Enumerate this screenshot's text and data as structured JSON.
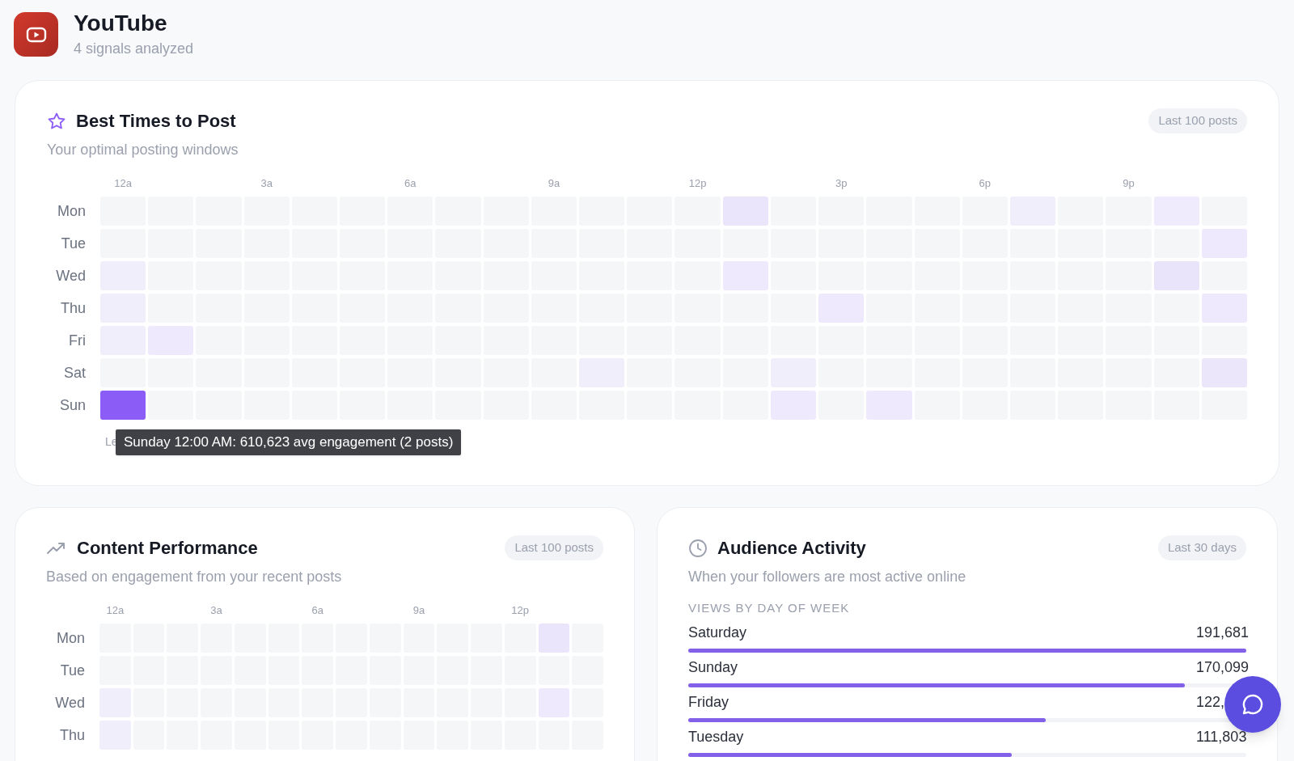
{
  "channel": {
    "name": "YouTube",
    "subtitle": "4 signals analyzed"
  },
  "best_times": {
    "title": "Best Times to Post",
    "subtitle": "Your optimal posting windows",
    "badge": "Last 100 posts",
    "hour_ticks": [
      "12a",
      "3a",
      "6a",
      "9a",
      "12p",
      "3p",
      "6p",
      "9p"
    ],
    "rows": [
      {
        "day": "Mon",
        "cells": [
          {
            "color": "#f5f6f8"
          },
          {
            "color": "#f5f6f8"
          },
          {
            "color": "#f5f6f8"
          },
          {
            "color": "#f5f6f8"
          },
          {
            "color": "#f5f6f8"
          },
          {
            "color": "#f5f6f8"
          },
          {
            "color": "#f5f6f8"
          },
          {
            "color": "#f5f6f8"
          },
          {
            "color": "#f5f6f8"
          },
          {
            "color": "#f5f6f8"
          },
          {
            "color": "#f5f6f8"
          },
          {
            "color": "#f5f6f8"
          },
          {
            "color": "#f5f6f8"
          },
          {
            "color": "#ebe5fb"
          },
          {
            "color": "#f5f6f8"
          },
          {
            "color": "#f5f6f8"
          },
          {
            "color": "#f5f6f8"
          },
          {
            "color": "#f5f6f8"
          },
          {
            "color": "#f5f6f8"
          },
          {
            "color": "#f1eefc"
          },
          {
            "color": "#f5f6f8"
          },
          {
            "color": "#f5f6f8"
          },
          {
            "color": "#efebfc"
          },
          {
            "color": "#f5f6f8"
          }
        ]
      },
      {
        "day": "Tue",
        "cells": [
          {
            "color": "#f5f6f8"
          },
          {
            "color": "#f5f6f8"
          },
          {
            "color": "#f5f6f8"
          },
          {
            "color": "#f5f6f8"
          },
          {
            "color": "#f5f6f8"
          },
          {
            "color": "#f5f6f8"
          },
          {
            "color": "#f5f6f8"
          },
          {
            "color": "#f5f6f8"
          },
          {
            "color": "#f5f6f8"
          },
          {
            "color": "#f5f6f8"
          },
          {
            "color": "#f5f6f8"
          },
          {
            "color": "#f5f6f8"
          },
          {
            "color": "#f5f6f8"
          },
          {
            "color": "#f5f6f8"
          },
          {
            "color": "#f5f6f8"
          },
          {
            "color": "#f5f6f8"
          },
          {
            "color": "#f5f6f8"
          },
          {
            "color": "#f5f6f8"
          },
          {
            "color": "#f5f6f8"
          },
          {
            "color": "#f5f6f8"
          },
          {
            "color": "#f5f6f8"
          },
          {
            "color": "#f5f6f8"
          },
          {
            "color": "#f5f6f8"
          },
          {
            "color": "#eee9fc"
          }
        ]
      },
      {
        "day": "Wed",
        "cells": [
          {
            "color": "#f1eefc"
          },
          {
            "color": "#f5f6f8"
          },
          {
            "color": "#f5f6f8"
          },
          {
            "color": "#f5f6f8"
          },
          {
            "color": "#f5f6f8"
          },
          {
            "color": "#f5f6f8"
          },
          {
            "color": "#f5f6f8"
          },
          {
            "color": "#f5f6f8"
          },
          {
            "color": "#f5f6f8"
          },
          {
            "color": "#f5f6f8"
          },
          {
            "color": "#f5f6f8"
          },
          {
            "color": "#f5f6f8"
          },
          {
            "color": "#f5f6f8"
          },
          {
            "color": "#eee9fc"
          },
          {
            "color": "#f5f6f8"
          },
          {
            "color": "#f5f6f8"
          },
          {
            "color": "#f5f6f8"
          },
          {
            "color": "#f5f6f8"
          },
          {
            "color": "#f5f6f8"
          },
          {
            "color": "#f5f6f8"
          },
          {
            "color": "#f5f6f8"
          },
          {
            "color": "#f5f6f8"
          },
          {
            "color": "#e9e4fa"
          },
          {
            "color": "#f5f6f8"
          }
        ]
      },
      {
        "day": "Thu",
        "cells": [
          {
            "color": "#f1eefc"
          },
          {
            "color": "#f5f6f8"
          },
          {
            "color": "#f5f6f8"
          },
          {
            "color": "#f5f6f8"
          },
          {
            "color": "#f5f6f8"
          },
          {
            "color": "#f5f6f8"
          },
          {
            "color": "#f5f6f8"
          },
          {
            "color": "#f5f6f8"
          },
          {
            "color": "#f5f6f8"
          },
          {
            "color": "#f5f6f8"
          },
          {
            "color": "#f5f6f8"
          },
          {
            "color": "#f5f6f8"
          },
          {
            "color": "#f5f6f8"
          },
          {
            "color": "#f5f6f8"
          },
          {
            "color": "#f5f6f8"
          },
          {
            "color": "#eee9fc"
          },
          {
            "color": "#f5f6f8"
          },
          {
            "color": "#f5f6f8"
          },
          {
            "color": "#f5f6f8"
          },
          {
            "color": "#f5f6f8"
          },
          {
            "color": "#f5f6f8"
          },
          {
            "color": "#f5f6f8"
          },
          {
            "color": "#f5f6f8"
          },
          {
            "color": "#eee9fc"
          }
        ]
      },
      {
        "day": "Fri",
        "cells": [
          {
            "color": "#f1eefc"
          },
          {
            "color": "#eee9fc"
          },
          {
            "color": "#f5f6f8"
          },
          {
            "color": "#f5f6f8"
          },
          {
            "color": "#f5f6f8"
          },
          {
            "color": "#f5f6f8"
          },
          {
            "color": "#f5f6f8"
          },
          {
            "color": "#f5f6f8"
          },
          {
            "color": "#f5f6f8"
          },
          {
            "color": "#f5f6f8"
          },
          {
            "color": "#f5f6f8"
          },
          {
            "color": "#f5f6f8"
          },
          {
            "color": "#f5f6f8"
          },
          {
            "color": "#f5f6f8"
          },
          {
            "color": "#f5f6f8"
          },
          {
            "color": "#f5f6f8"
          },
          {
            "color": "#f5f6f8"
          },
          {
            "color": "#f5f6f8"
          },
          {
            "color": "#f5f6f8"
          },
          {
            "color": "#f5f6f8"
          },
          {
            "color": "#f5f6f8"
          },
          {
            "color": "#f5f6f8"
          },
          {
            "color": "#f5f6f8"
          },
          {
            "color": "#f5f6f8"
          }
        ]
      },
      {
        "day": "Sat",
        "cells": [
          {
            "color": "#f5f6f8"
          },
          {
            "color": "#f5f6f8"
          },
          {
            "color": "#f5f6f8"
          },
          {
            "color": "#f5f6f8"
          },
          {
            "color": "#f5f6f8"
          },
          {
            "color": "#f5f6f8"
          },
          {
            "color": "#f5f6f8"
          },
          {
            "color": "#f5f6f8"
          },
          {
            "color": "#f5f6f8"
          },
          {
            "color": "#f5f6f8"
          },
          {
            "color": "#f1eefc"
          },
          {
            "color": "#f5f6f8"
          },
          {
            "color": "#f5f6f8"
          },
          {
            "color": "#f5f6f8"
          },
          {
            "color": "#f1eefc"
          },
          {
            "color": "#f5f6f8"
          },
          {
            "color": "#f5f6f8"
          },
          {
            "color": "#f5f6f8"
          },
          {
            "color": "#f5f6f8"
          },
          {
            "color": "#f5f6f8"
          },
          {
            "color": "#f5f6f8"
          },
          {
            "color": "#f5f6f8"
          },
          {
            "color": "#f5f6f8"
          },
          {
            "color": "#ece6fb"
          }
        ]
      },
      {
        "day": "Sun",
        "cells": [
          {
            "color": "#8b5cf6"
          },
          {
            "color": "#f5f6f8"
          },
          {
            "color": "#f5f6f8"
          },
          {
            "color": "#f5f6f8"
          },
          {
            "color": "#f5f6f8"
          },
          {
            "color": "#f5f6f8"
          },
          {
            "color": "#f5f6f8"
          },
          {
            "color": "#f5f6f8"
          },
          {
            "color": "#f5f6f8"
          },
          {
            "color": "#f5f6f8"
          },
          {
            "color": "#f5f6f8"
          },
          {
            "color": "#f5f6f8"
          },
          {
            "color": "#f5f6f8"
          },
          {
            "color": "#f5f6f8"
          },
          {
            "color": "#eee9fc"
          },
          {
            "color": "#f5f6f8"
          },
          {
            "color": "#eee9fc"
          },
          {
            "color": "#f5f6f8"
          },
          {
            "color": "#f5f6f8"
          },
          {
            "color": "#f5f6f8"
          },
          {
            "color": "#f5f6f8"
          },
          {
            "color": "#f5f6f8"
          },
          {
            "color": "#f5f6f8"
          },
          {
            "color": "#f5f6f8"
          }
        ]
      }
    ],
    "legend": "Le",
    "tooltip": "Sunday 12:00 AM: 610,623 avg engagement (2 posts)"
  },
  "content_performance": {
    "title": "Content Performance",
    "subtitle": "Based on engagement from your recent posts",
    "badge": "Last 100 posts",
    "hour_ticks": [
      "12a",
      "3a",
      "6a",
      "9a",
      "12p"
    ],
    "rows": [
      {
        "day": "Mon",
        "cells": [
          {
            "color": "#f5f6f8"
          },
          {
            "color": "#f5f6f8"
          },
          {
            "color": "#f5f6f8"
          },
          {
            "color": "#f5f6f8"
          },
          {
            "color": "#f5f6f8"
          },
          {
            "color": "#f5f6f8"
          },
          {
            "color": "#f5f6f8"
          },
          {
            "color": "#f5f6f8"
          },
          {
            "color": "#f5f6f8"
          },
          {
            "color": "#f5f6f8"
          },
          {
            "color": "#f5f6f8"
          },
          {
            "color": "#f5f6f8"
          },
          {
            "color": "#f5f6f8"
          },
          {
            "color": "#ebe5fb"
          },
          {
            "color": "#f5f6f8"
          }
        ]
      },
      {
        "day": "Tue",
        "cells": [
          {
            "color": "#f5f6f8"
          },
          {
            "color": "#f5f6f8"
          },
          {
            "color": "#f5f6f8"
          },
          {
            "color": "#f5f6f8"
          },
          {
            "color": "#f5f6f8"
          },
          {
            "color": "#f5f6f8"
          },
          {
            "color": "#f5f6f8"
          },
          {
            "color": "#f5f6f8"
          },
          {
            "color": "#f5f6f8"
          },
          {
            "color": "#f5f6f8"
          },
          {
            "color": "#f5f6f8"
          },
          {
            "color": "#f5f6f8"
          },
          {
            "color": "#f5f6f8"
          },
          {
            "color": "#f5f6f8"
          },
          {
            "color": "#f5f6f8"
          }
        ]
      },
      {
        "day": "Wed",
        "cells": [
          {
            "color": "#f1eefc"
          },
          {
            "color": "#f5f6f8"
          },
          {
            "color": "#f5f6f8"
          },
          {
            "color": "#f5f6f8"
          },
          {
            "color": "#f5f6f8"
          },
          {
            "color": "#f5f6f8"
          },
          {
            "color": "#f5f6f8"
          },
          {
            "color": "#f5f6f8"
          },
          {
            "color": "#f5f6f8"
          },
          {
            "color": "#f5f6f8"
          },
          {
            "color": "#f5f6f8"
          },
          {
            "color": "#f5f6f8"
          },
          {
            "color": "#f5f6f8"
          },
          {
            "color": "#eee9fc"
          },
          {
            "color": "#f5f6f8"
          }
        ]
      },
      {
        "day": "Thu",
        "cells": [
          {
            "color": "#f1eefc"
          },
          {
            "color": "#f5f6f8"
          },
          {
            "color": "#f5f6f8"
          },
          {
            "color": "#f5f6f8"
          },
          {
            "color": "#f5f6f8"
          },
          {
            "color": "#f5f6f8"
          },
          {
            "color": "#f5f6f8"
          },
          {
            "color": "#f5f6f8"
          },
          {
            "color": "#f5f6f8"
          },
          {
            "color": "#f5f6f8"
          },
          {
            "color": "#f5f6f8"
          },
          {
            "color": "#f5f6f8"
          },
          {
            "color": "#f5f6f8"
          },
          {
            "color": "#f5f6f8"
          },
          {
            "color": "#f5f6f8"
          }
        ]
      }
    ]
  },
  "audience_activity": {
    "title": "Audience Activity",
    "subtitle": "When your followers are most active online",
    "badge": "Last 30 days",
    "section_label": "VIEWS BY DAY OF WEEK",
    "days": [
      {
        "day": "Saturday",
        "views": "191,681",
        "level": 1
      },
      {
        "day": "Sunday",
        "views": "170,099",
        "level": 0.89
      },
      {
        "day": "Friday",
        "views": "122,",
        "level": 0.64
      },
      {
        "day": "Tuesday",
        "views": "111,803",
        "level": 0.58
      }
    ]
  }
}
